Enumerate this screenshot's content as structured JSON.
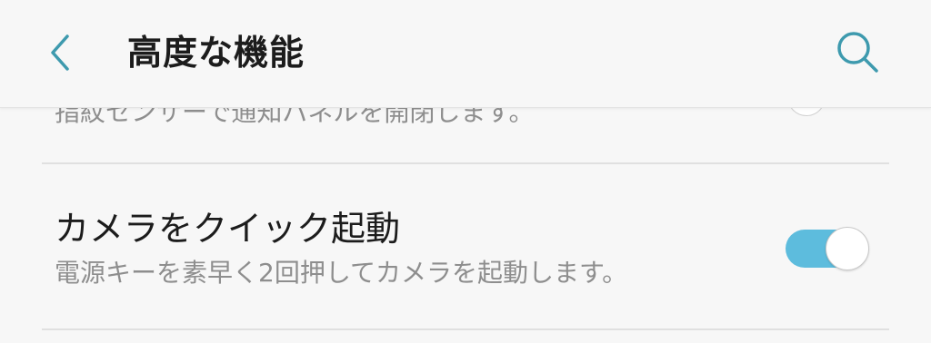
{
  "header": {
    "back_icon": "chevron-left-icon",
    "title": "高度な機能",
    "search_icon": "search-icon"
  },
  "colors": {
    "accent": "#3e9aae",
    "toggle_on": "#5dbcdd"
  },
  "settings": {
    "previous_item_summary": "指紋センサーで通知パネルを開閉します。",
    "quick_launch_camera": {
      "title": "カメラをクイック起動",
      "summary": "電源キーを素早く2回押してカメラを起動します。",
      "enabled": true
    }
  }
}
